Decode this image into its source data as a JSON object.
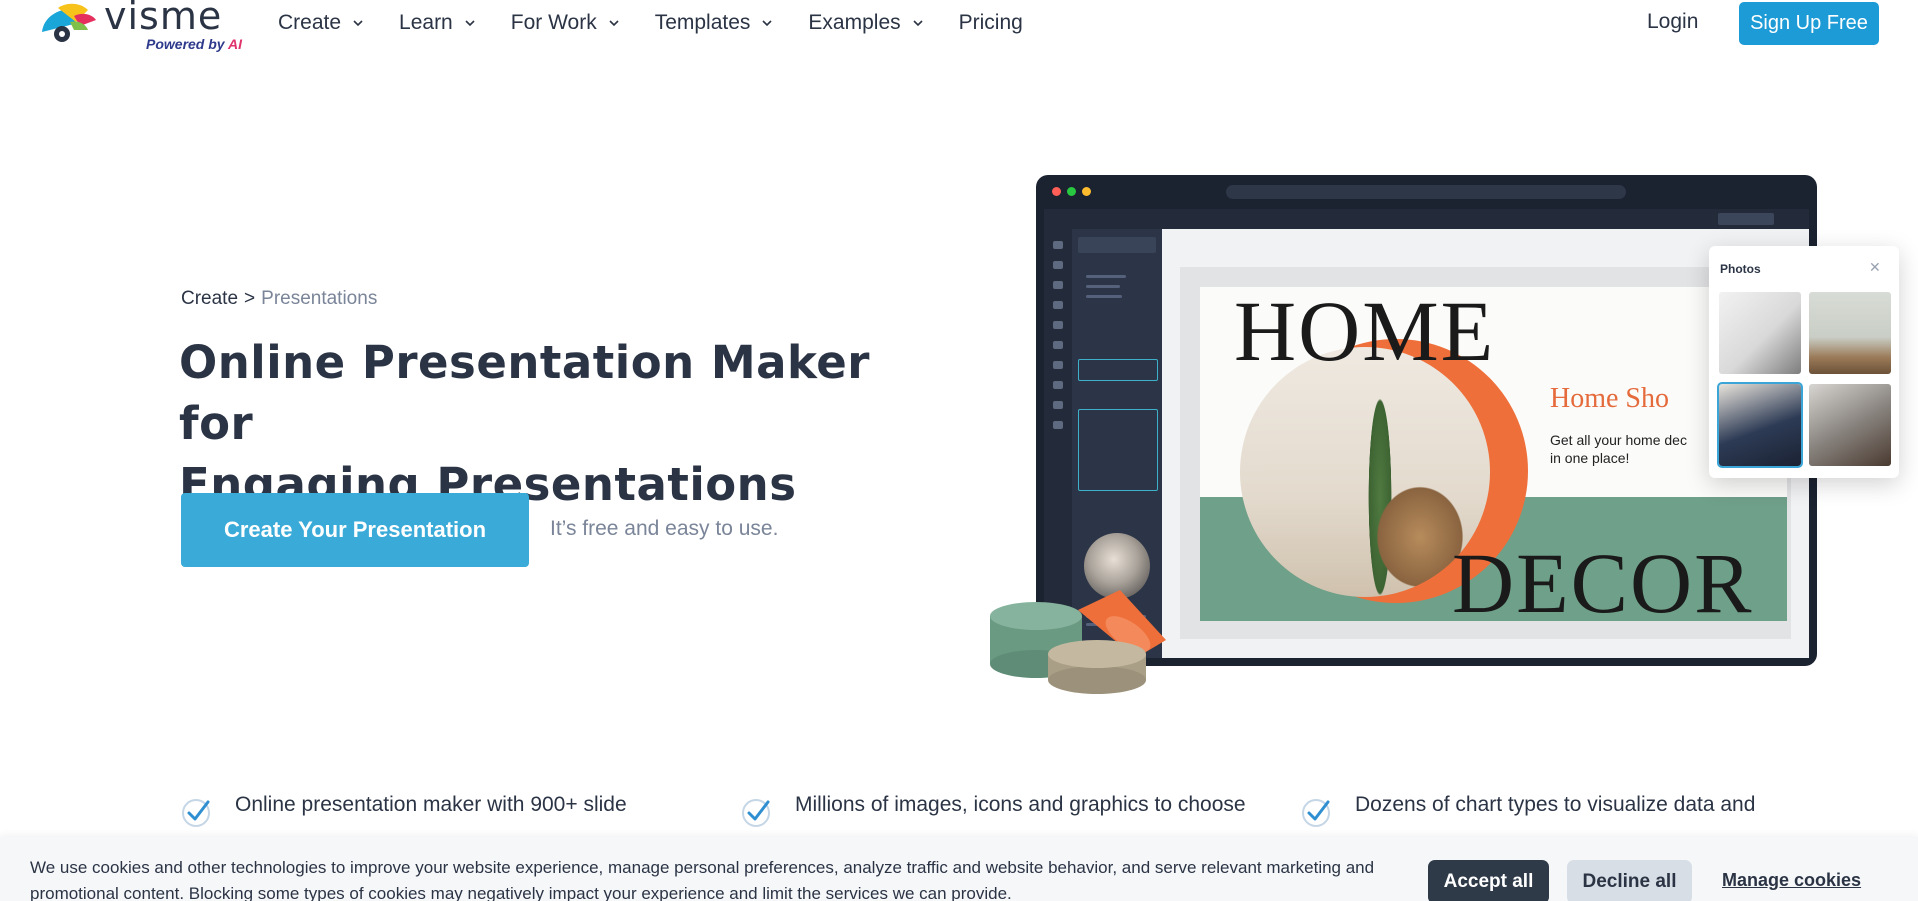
{
  "header": {
    "logo_text": "visme",
    "logo_sub_prefix": "Powered by ",
    "logo_sub_ai": "AI",
    "nav": [
      {
        "label": "Create",
        "has_dropdown": true
      },
      {
        "label": "Learn",
        "has_dropdown": true
      },
      {
        "label": "For Work",
        "has_dropdown": true
      },
      {
        "label": "Templates",
        "has_dropdown": true
      },
      {
        "label": "Examples",
        "has_dropdown": true
      },
      {
        "label": "Pricing",
        "has_dropdown": false
      }
    ],
    "login_label": "Login",
    "signup_label": "Sign Up Free"
  },
  "hero": {
    "breadcrumb": {
      "parent": "Create",
      "separator": ">",
      "current": "Presentations"
    },
    "title_line1": "Online Presentation Maker for",
    "title_line2": "Engaging Presentations",
    "cta_label": "Create Your Presentation",
    "cta_note": "It’s free and easy to use."
  },
  "mockup": {
    "slide_home": "HOME",
    "slide_decor": "DECOR",
    "slide_brand": "Home Sho",
    "slide_copy_line1": "Get all your home dec",
    "slide_copy_line2": "in one place!",
    "photos_title": "Photos",
    "photos_close": "✕"
  },
  "features": [
    {
      "text": "Online presentation maker with 900+ slide"
    },
    {
      "text": "Millions of images, icons and graphics to choose"
    },
    {
      "text": "Dozens of chart types to visualize data and"
    }
  ],
  "cookie": {
    "text": "We use cookies and other technologies to improve your website experience, manage personal preferences, analyze traffic and website behavior, and serve relevant marketing and promotional content. Blocking some types of cookies may negatively impact your experience and limit the services we can provide.",
    "accept_label": "Accept all",
    "decline_label": "Decline all",
    "manage_label": "Manage cookies"
  },
  "colors": {
    "brand_blue": "#1c9bd6",
    "cta_blue": "#3aabd8",
    "text_dark": "#2b3445",
    "text_muted": "#7a8599",
    "accent_orange": "#ef6f3a",
    "accent_green": "#6fa08a",
    "cookie_accept": "#2f3a48"
  },
  "icons": {
    "logo": "chameleon-logo-icon",
    "nav_chevron": "chevron-down-icon",
    "feature_check": "check-circle-icon",
    "close": "close-icon"
  }
}
